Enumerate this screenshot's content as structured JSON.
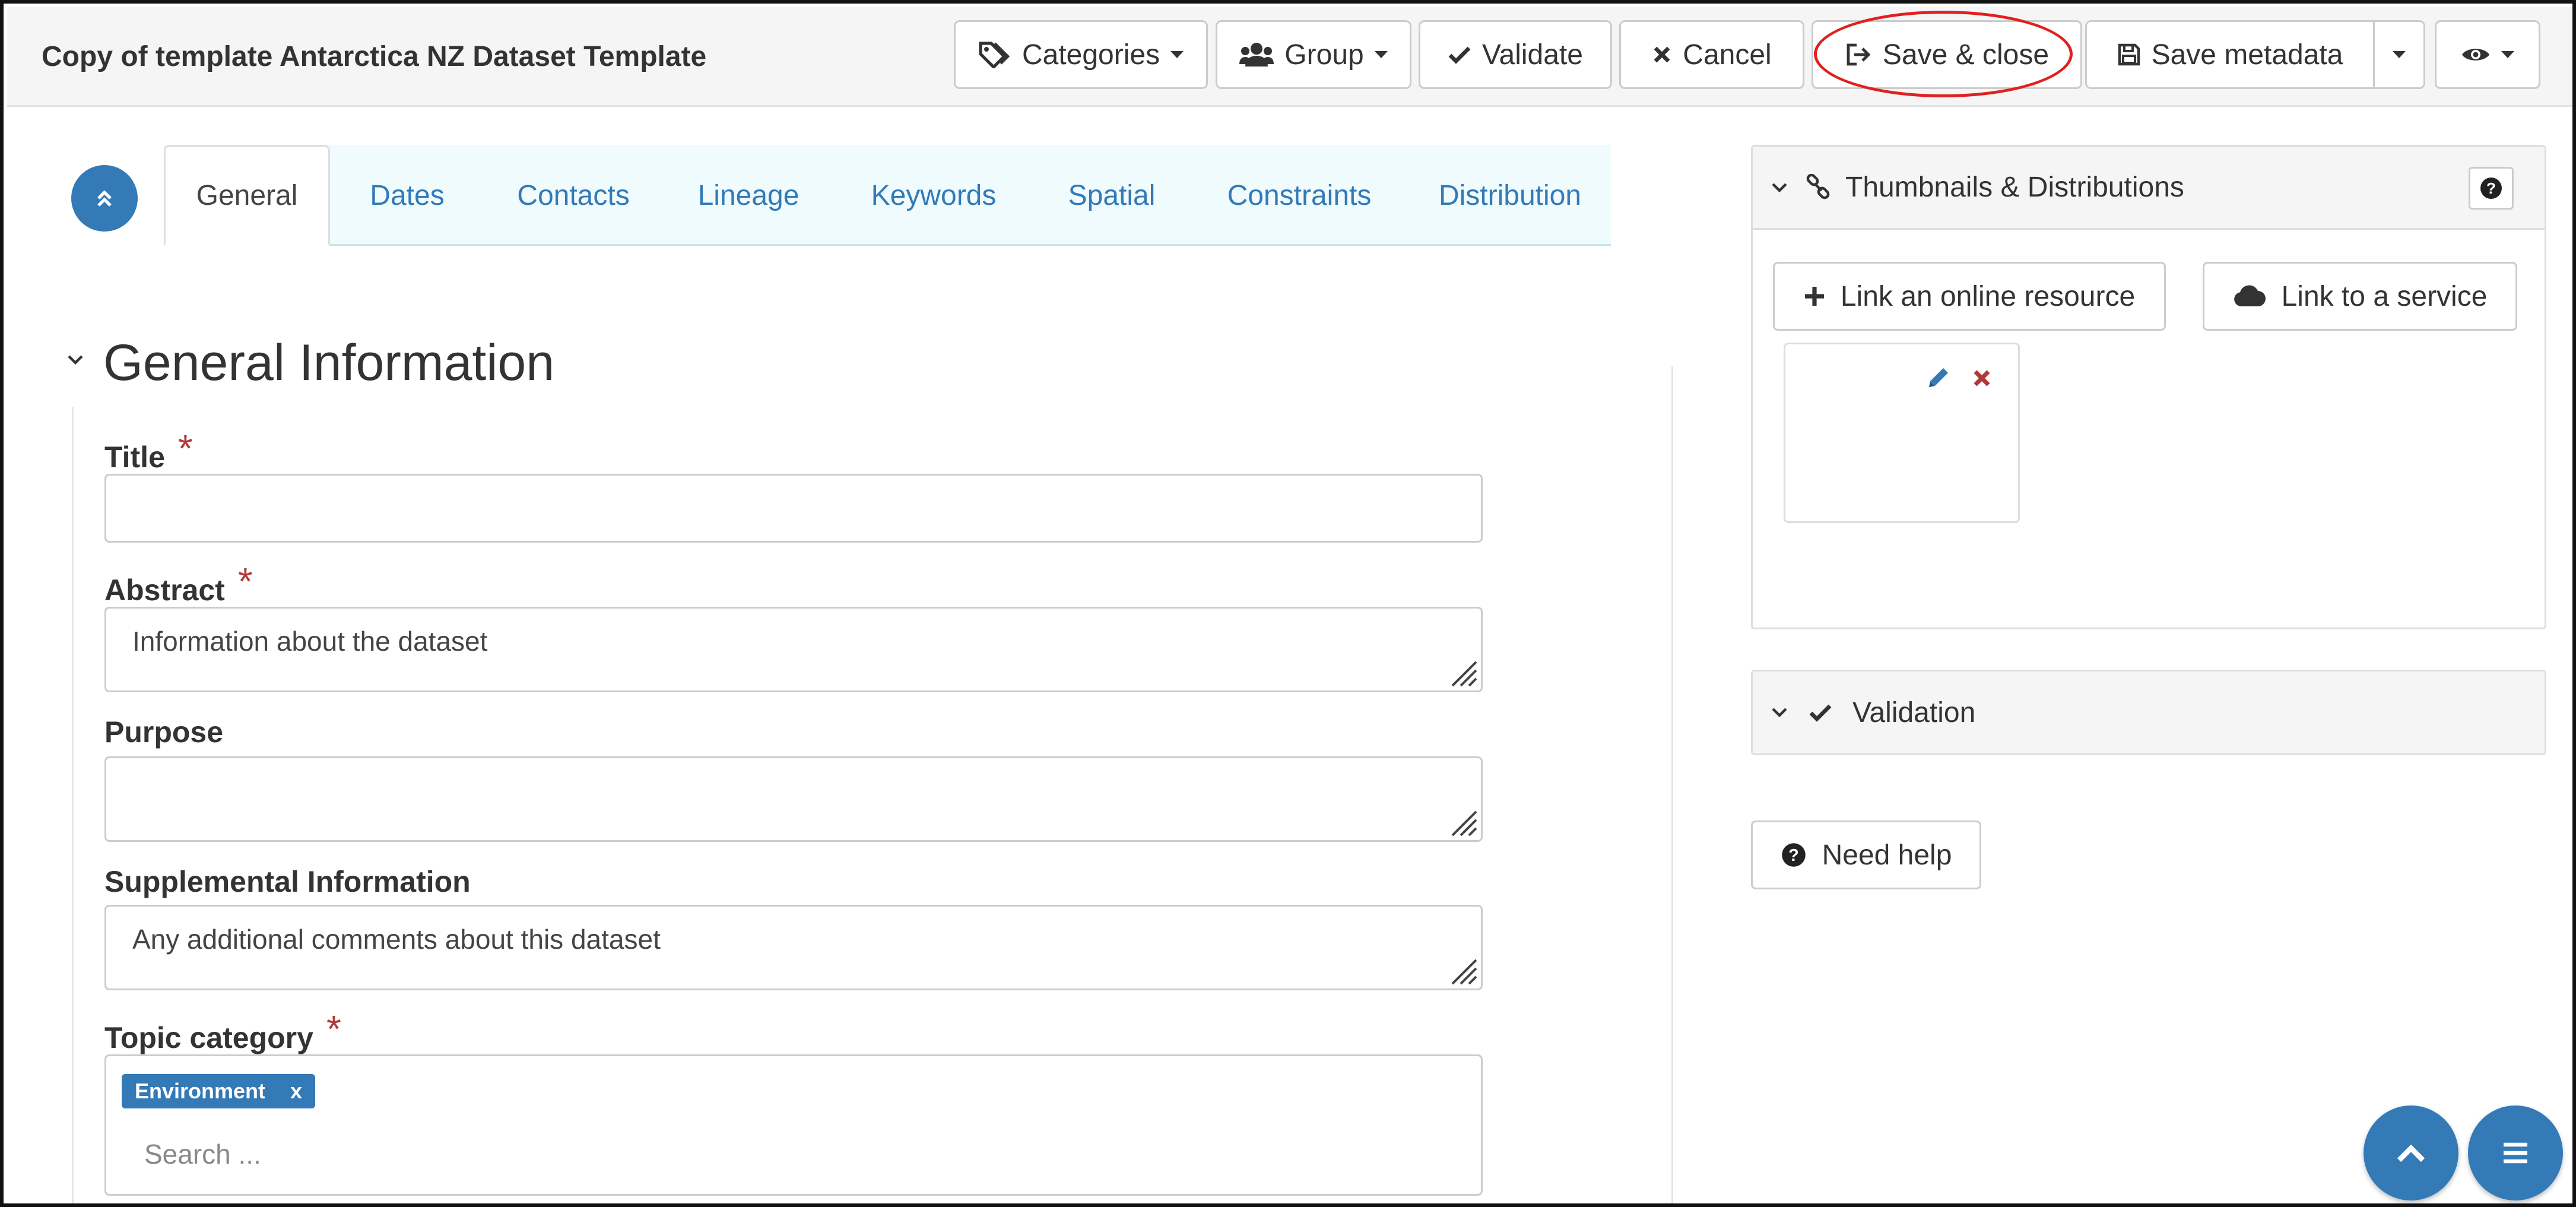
{
  "header": {
    "title": "Copy of template Antarctica NZ Dataset Template",
    "buttons": {
      "categories": "Categories",
      "group": "Group",
      "validate": "Validate",
      "cancel": "Cancel",
      "save_close": "Save & close",
      "save_metadata": "Save metadata"
    }
  },
  "tabs": [
    "General",
    "Dates",
    "Contacts",
    "Lineage",
    "Keywords",
    "Spatial",
    "Constraints",
    "Distribution"
  ],
  "active_tab": "General",
  "section": {
    "title": "General Information",
    "fields": {
      "title": {
        "label": "Title",
        "required": true,
        "value": ""
      },
      "abstract": {
        "label": "Abstract",
        "required": true,
        "value": "Information about the dataset"
      },
      "purpose": {
        "label": "Purpose",
        "required": false,
        "value": ""
      },
      "supplemental": {
        "label": "Supplemental Information",
        "required": false,
        "value": "Any additional comments about this dataset"
      },
      "topic": {
        "label": "Topic category",
        "required": true,
        "tag": "Environment",
        "tag_remove": "x",
        "placeholder": "Search ..."
      }
    },
    "required_mark": "*"
  },
  "sidebar": {
    "thumbnails": {
      "title": "Thumbnails & Distributions",
      "link_online": "Link an online resource",
      "link_service": "Link to a service"
    },
    "validation": {
      "title": "Validation"
    },
    "help": "Need help"
  },
  "colors": {
    "primary": "#337ab7",
    "danger": "#b03a3a",
    "highlight": "#e02020",
    "tab_bg": "#f0fbfd"
  }
}
